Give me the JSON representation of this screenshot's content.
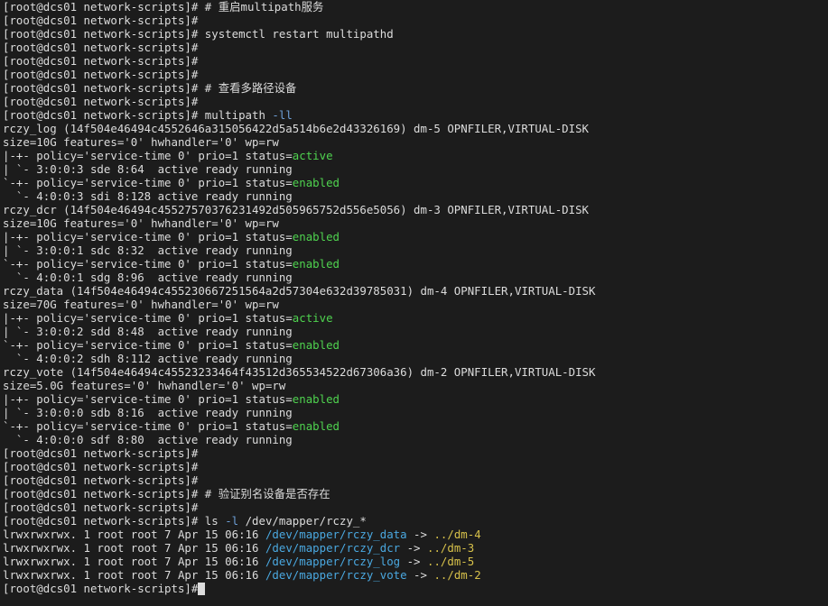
{
  "colors": {
    "background": "#1c1c1c",
    "text": "#dcdcdc",
    "status_green": "#4fd34f",
    "symlink_blue": "#4aa8e0",
    "target_yellow": "#d7c14a",
    "option_flag": "#6ea0d8"
  },
  "lines": [
    [
      {
        "t": "[root@dcs01 network-scripts]# # 重启multipath服务",
        "c": "default"
      }
    ],
    [
      {
        "t": "[root@dcs01 network-scripts]#",
        "c": "default"
      }
    ],
    [
      {
        "t": "[root@dcs01 network-scripts]# systemctl restart multipathd",
        "c": "default"
      }
    ],
    [
      {
        "t": "[root@dcs01 network-scripts]#",
        "c": "default"
      }
    ],
    [
      {
        "t": "[root@dcs01 network-scripts]#",
        "c": "default"
      }
    ],
    [
      {
        "t": "[root@dcs01 network-scripts]#",
        "c": "default"
      }
    ],
    [
      {
        "t": "[root@dcs01 network-scripts]# # 查看多路径设备",
        "c": "default"
      }
    ],
    [
      {
        "t": "[root@dcs01 network-scripts]#",
        "c": "default"
      }
    ],
    [
      {
        "t": "[root@dcs01 network-scripts]# multipath ",
        "c": "default"
      },
      {
        "t": "-ll",
        "c": "flag"
      }
    ],
    [
      {
        "t": "rczy_log (14f504e46494c4552646a315056422d5a514b6e2d43326169) dm-5 OPNFILER,VIRTUAL-DISK",
        "c": "default"
      }
    ],
    [
      {
        "t": "size=10G features='0' hwhandler='0' wp=rw",
        "c": "default"
      }
    ],
    [
      {
        "t": "|-+- policy='service-time 0' prio=1 status=",
        "c": "default"
      },
      {
        "t": "active",
        "c": "green"
      }
    ],
    [
      {
        "t": "| `- 3:0:0:3 sde 8:64  active ready running",
        "c": "default"
      }
    ],
    [
      {
        "t": "`-+- policy='service-time 0' prio=1 status=",
        "c": "default"
      },
      {
        "t": "enabled",
        "c": "green"
      }
    ],
    [
      {
        "t": "  `- 4:0:0:3 sdi 8:128 active ready running",
        "c": "default"
      }
    ],
    [
      {
        "t": "rczy_dcr (14f504e46494c45527570376231492d505965752d556e5056) dm-3 OPNFILER,VIRTUAL-DISK",
        "c": "default"
      }
    ],
    [
      {
        "t": "size=10G features='0' hwhandler='0' wp=rw",
        "c": "default"
      }
    ],
    [
      {
        "t": "|-+- policy='service-time 0' prio=1 status=",
        "c": "default"
      },
      {
        "t": "enabled",
        "c": "green"
      }
    ],
    [
      {
        "t": "| `- 3:0:0:1 sdc 8:32  active ready running",
        "c": "default"
      }
    ],
    [
      {
        "t": "`-+- policy='service-time 0' prio=1 status=",
        "c": "default"
      },
      {
        "t": "enabled",
        "c": "green"
      }
    ],
    [
      {
        "t": "  `- 4:0:0:1 sdg 8:96  active ready running",
        "c": "default"
      }
    ],
    [
      {
        "t": "rczy_data (14f504e46494c455230667251564a2d57304e632d39785031) dm-4 OPNFILER,VIRTUAL-DISK",
        "c": "default"
      }
    ],
    [
      {
        "t": "size=70G features='0' hwhandler='0' wp=rw",
        "c": "default"
      }
    ],
    [
      {
        "t": "|-+- policy='service-time 0' prio=1 status=",
        "c": "default"
      },
      {
        "t": "active",
        "c": "green"
      }
    ],
    [
      {
        "t": "| `- 3:0:0:2 sdd 8:48  active ready running",
        "c": "default"
      }
    ],
    [
      {
        "t": "`-+- policy='service-time 0' prio=1 status=",
        "c": "default"
      },
      {
        "t": "enabled",
        "c": "green"
      }
    ],
    [
      {
        "t": "  `- 4:0:0:2 sdh 8:112 active ready running",
        "c": "default"
      }
    ],
    [
      {
        "t": "rczy_vote (14f504e46494c45523233464f43512d365534522d67306a36) dm-2 OPNFILER,VIRTUAL-DISK",
        "c": "default"
      }
    ],
    [
      {
        "t": "size=5.0G features='0' hwhandler='0' wp=rw",
        "c": "default"
      }
    ],
    [
      {
        "t": "|-+- policy='service-time 0' prio=1 status=",
        "c": "default"
      },
      {
        "t": "enabled",
        "c": "green"
      }
    ],
    [
      {
        "t": "| `- 3:0:0:0 sdb 8:16  active ready running",
        "c": "default"
      }
    ],
    [
      {
        "t": "`-+- policy='service-time 0' prio=1 status=",
        "c": "default"
      },
      {
        "t": "enabled",
        "c": "green"
      }
    ],
    [
      {
        "t": "  `- 4:0:0:0 sdf 8:80  active ready running",
        "c": "default"
      }
    ],
    [
      {
        "t": "[root@dcs01 network-scripts]#",
        "c": "default"
      }
    ],
    [
      {
        "t": "[root@dcs01 network-scripts]#",
        "c": "default"
      }
    ],
    [
      {
        "t": "[root@dcs01 network-scripts]#",
        "c": "default"
      }
    ],
    [
      {
        "t": "[root@dcs01 network-scripts]# # 验证别名设备是否存在",
        "c": "default"
      }
    ],
    [
      {
        "t": "[root@dcs01 network-scripts]#",
        "c": "default"
      }
    ],
    [
      {
        "t": "[root@dcs01 network-scripts]# ls ",
        "c": "default"
      },
      {
        "t": "-l",
        "c": "flag"
      },
      {
        "t": " /dev/mapper/rczy_*",
        "c": "default"
      }
    ],
    [
      {
        "t": "lrwxrwxrwx. 1 root root 7 Apr 15 06:16 ",
        "c": "default"
      },
      {
        "t": "/dev/mapper/rczy_data",
        "c": "blue"
      },
      {
        "t": " -> ",
        "c": "default"
      },
      {
        "t": "../dm-4",
        "c": "yellow"
      }
    ],
    [
      {
        "t": "lrwxrwxrwx. 1 root root 7 Apr 15 06:16 ",
        "c": "default"
      },
      {
        "t": "/dev/mapper/rczy_dcr",
        "c": "blue"
      },
      {
        "t": " -> ",
        "c": "default"
      },
      {
        "t": "../dm-3",
        "c": "yellow"
      }
    ],
    [
      {
        "t": "lrwxrwxrwx. 1 root root 7 Apr 15 06:16 ",
        "c": "default"
      },
      {
        "t": "/dev/mapper/rczy_log",
        "c": "blue"
      },
      {
        "t": " -> ",
        "c": "default"
      },
      {
        "t": "../dm-5",
        "c": "yellow"
      }
    ],
    [
      {
        "t": "lrwxrwxrwx. 1 root root 7 Apr 15 06:16 ",
        "c": "default"
      },
      {
        "t": "/dev/mapper/rczy_vote",
        "c": "blue"
      },
      {
        "t": " -> ",
        "c": "default"
      },
      {
        "t": "../dm-2",
        "c": "yellow"
      }
    ]
  ],
  "prompt": "[root@dcs01 network-scripts]#"
}
